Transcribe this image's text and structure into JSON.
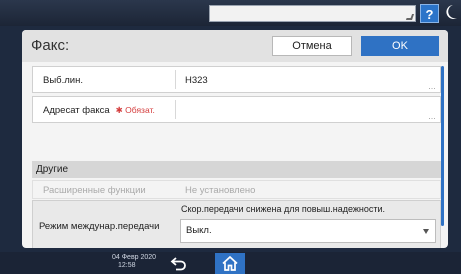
{
  "topbar": {
    "help_label": "?"
  },
  "dialog": {
    "title": "Факс:",
    "cancel_label": "Отмена",
    "ok_label": "OK"
  },
  "rows": {
    "line": {
      "label": "Выб.лин.",
      "value": "H323"
    },
    "dest": {
      "label": "Адресат факса",
      "required": "✱ Обязат.",
      "value": ""
    },
    "section_other": "Другие",
    "extended": {
      "label": "Расширенные функции",
      "value": "Не установлено"
    },
    "mode": {
      "label": "Режим междунар.передачи",
      "note": "Скор.передачи снижена для повыш.надежности.",
      "selected": "Выкл."
    }
  },
  "status": {
    "date": "04 Февр 2020",
    "time": "12:58"
  },
  "colors": {
    "accent": "#2f72c4",
    "required": "#d43c3c"
  }
}
